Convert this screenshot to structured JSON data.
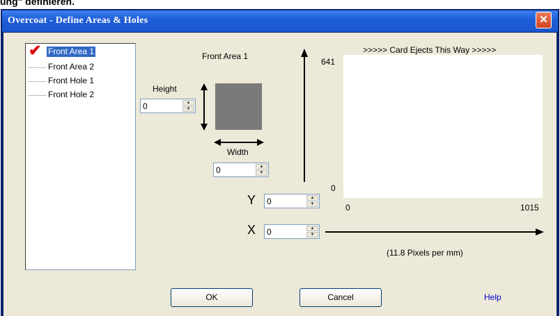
{
  "page_heading": "ung\" definieren.",
  "window": {
    "title": "Overcoat - Define Areas & Holes",
    "close_glyph": "✕"
  },
  "tree": {
    "items": [
      {
        "label": "Front Area 1",
        "selected": true,
        "checked": true
      },
      {
        "label": "Front Area 2",
        "selected": false
      },
      {
        "label": "Front Hole 1",
        "selected": false
      },
      {
        "label": "Front Hole 2",
        "selected": false
      }
    ]
  },
  "area_editor": {
    "area_name": "Front Area 1",
    "height_label": "Height",
    "height_value": "0",
    "width_label": "Width",
    "width_value": "0"
  },
  "preview": {
    "caption": ">>>>> Card Ejects This Way >>>>>",
    "y_max": "641",
    "y_min": "0",
    "x_min": "0",
    "x_max": "1015",
    "scale_note": "(11.8 Pixels per mm)"
  },
  "position": {
    "y_label": "Y",
    "y_value": "0",
    "x_label": "X",
    "x_value": "0"
  },
  "buttons": {
    "ok": "OK",
    "cancel": "Cancel",
    "help": "Help"
  },
  "colors": {
    "titlebar": "#1f5fd9",
    "selection": "#316ac5",
    "check": "#e00000",
    "dialog_bg": "#ece9d8"
  }
}
